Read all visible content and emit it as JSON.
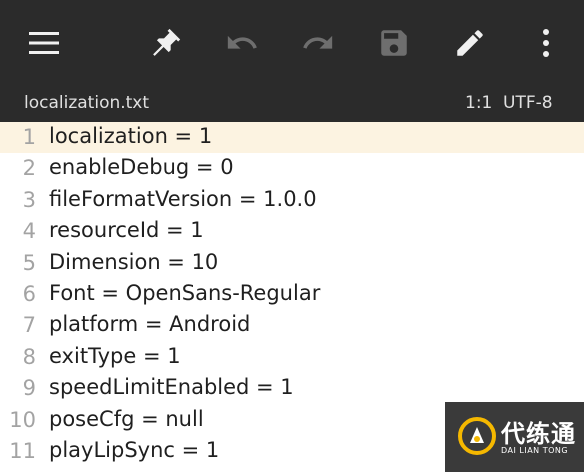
{
  "toolbar": {
    "icons": [
      "menu-icon",
      "pin-icon",
      "undo-icon",
      "redo-icon",
      "save-icon",
      "pencil-icon",
      "more-vert-icon"
    ]
  },
  "status": {
    "filename": "localization.txt",
    "cursor": "1:1",
    "encoding": "UTF-8"
  },
  "editor": {
    "current_line": 1,
    "lines": [
      {
        "num": "1",
        "text": "localization = 1"
      },
      {
        "num": "2",
        "text": "enableDebug = 0"
      },
      {
        "num": "3",
        "text": "fileFormatVersion = 1.0.0"
      },
      {
        "num": "4",
        "text": "resourceId = 1"
      },
      {
        "num": "5",
        "text": "Dimension = 10"
      },
      {
        "num": "6",
        "text": "Font = OpenSans-Regular"
      },
      {
        "num": "7",
        "text": "platform = Android"
      },
      {
        "num": "8",
        "text": "exitType = 1"
      },
      {
        "num": "9",
        "text": "speedLimitEnabled = 1"
      },
      {
        "num": "10",
        "text": "poseCfg = null"
      },
      {
        "num": "11",
        "text": "playLipSync = 1"
      }
    ]
  },
  "watermark": {
    "title": "代练通",
    "subtitle": "DAI LIAN TONG"
  },
  "colors": {
    "toolbar_bg": "#2b2b2b",
    "icon_active": "#f0f0f0",
    "icon_disabled": "#6e6e6e",
    "current_line_bg": "#fcf3e1",
    "line_number": "#a3a3a3",
    "watermark_accent": "#f5b800"
  }
}
